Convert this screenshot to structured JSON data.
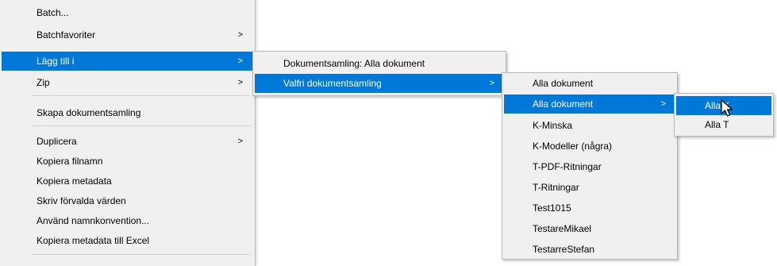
{
  "main_menu": {
    "items": [
      {
        "label": "Batch...",
        "has_submenu": false
      },
      {
        "label": "Batchfavoriter",
        "has_submenu": true
      },
      {
        "label": "Lägg till i",
        "has_submenu": true,
        "highlighted": true
      },
      {
        "label": "Zip",
        "has_submenu": true
      },
      {
        "label": "Skapa dokumentsamling",
        "has_submenu": false
      },
      {
        "label": "Duplicera",
        "has_submenu": true
      },
      {
        "label": "Kopiera filnamn",
        "has_submenu": false
      },
      {
        "label": "Kopiera metadata",
        "has_submenu": false
      },
      {
        "label": "Skriv förvalda värden",
        "has_submenu": false
      },
      {
        "label": "Använd namnkonvention...",
        "has_submenu": false
      },
      {
        "label": "Kopiera metadata till Excel",
        "has_submenu": false
      }
    ]
  },
  "submenu_lagg_till": {
    "items": [
      {
        "label": "Dokumentsamling: Alla dokument",
        "has_submenu": false
      },
      {
        "label": "Valfri dokumentsamling",
        "has_submenu": true,
        "highlighted": true
      }
    ]
  },
  "submenu_valfri": {
    "items": [
      {
        "label": "Alla dokument",
        "has_submenu": false
      },
      {
        "label": "Alla dokument",
        "has_submenu": true,
        "highlighted": true
      },
      {
        "label": "K-Minska",
        "has_submenu": false
      },
      {
        "label": "K-Modeller (några)",
        "has_submenu": false
      },
      {
        "label": "T-PDF-Ritningar",
        "has_submenu": false
      },
      {
        "label": "T-Ritningar",
        "has_submenu": false
      },
      {
        "label": "Test1015",
        "has_submenu": false
      },
      {
        "label": "TestareMikael",
        "has_submenu": false
      },
      {
        "label": "TestarreStefan",
        "has_submenu": false
      }
    ]
  },
  "submenu_alla": {
    "items": [
      {
        "label": "Alla K",
        "has_submenu": false,
        "highlighted": true
      },
      {
        "label": "Alla T",
        "has_submenu": false
      }
    ]
  },
  "icons": {
    "submenu_arrow": ">",
    "cursor": "arrow-cursor-icon"
  },
  "colors": {
    "menu_background": "#f0f0f0",
    "highlight": "#0078d7",
    "highlight_text": "#ffffff",
    "separator": "#d0d0d0"
  }
}
